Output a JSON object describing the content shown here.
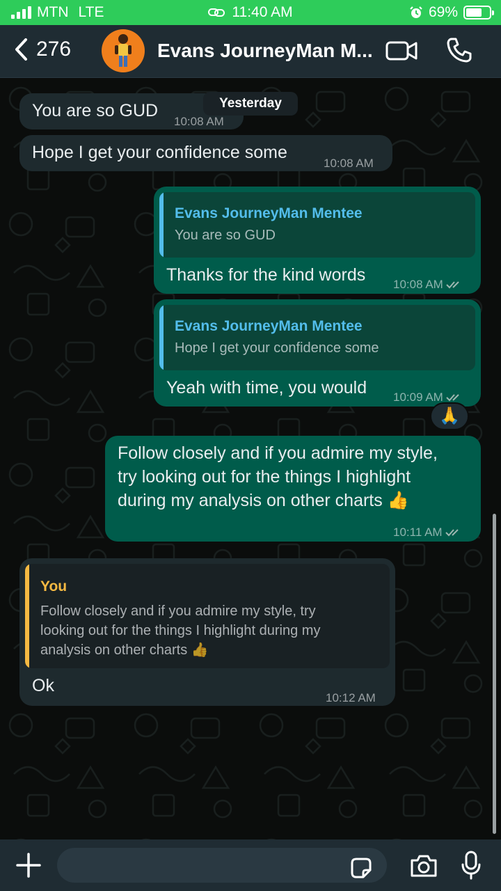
{
  "status_bar": {
    "carrier": "MTN",
    "network": "LTE",
    "time": "11:40 AM",
    "battery": "69%",
    "battery_level": 0.69,
    "icons": [
      "signal-icon",
      "link-icon",
      "alarm-icon",
      "battery-icon"
    ]
  },
  "header": {
    "back_count": "276",
    "title": "Evans JourneyMan M...",
    "icons": [
      "back-chevron-icon",
      "avatar",
      "video-call-icon",
      "phone-call-icon"
    ]
  },
  "chat": {
    "date_label": "Yesterday",
    "messages": [
      {
        "dir": "in",
        "text": "You are so GUD",
        "time": "10:08 AM"
      },
      {
        "dir": "in",
        "text": "Hope I get your confidence some",
        "time": "10:08 AM"
      },
      {
        "dir": "out",
        "quote_name": "Evans JourneyMan Mentee",
        "quote_text": "You are so GUD",
        "text": "Thanks for the kind words",
        "time": "10:08 AM"
      },
      {
        "dir": "out",
        "quote_name": "Evans JourneyMan Mentee",
        "quote_text": "Hope I get your confidence some",
        "text": "Yeah with time, you would",
        "time": "10:09 AM",
        "reaction": "🙏"
      },
      {
        "dir": "out",
        "lines": [
          "Follow closely and if you admire my style,",
          "try looking out for the things I highlight",
          "during my analysis on other charts 👍"
        ],
        "time": "10:11 AM"
      },
      {
        "dir": "in",
        "quote_name": "You",
        "quote_lines": [
          "Follow closely and if you admire my style, try",
          "looking out for the things I highlight during my",
          "analysis on other charts 👍"
        ],
        "text": "Ok",
        "time": "10:12 AM"
      }
    ]
  },
  "input_bar": {
    "message_value": "",
    "icons": [
      "plus-icon",
      "sticker-icon",
      "camera-icon",
      "microphone-icon"
    ]
  },
  "colors": {
    "status_bar": "#2ecc5a",
    "outgoing_bubble": "#005c4b",
    "incoming_bubble": "#1e2a2e",
    "quote_name_contact": "#53bdeb",
    "quote_name_you": "#f5b942",
    "read_tick": "#9fb7b1"
  }
}
